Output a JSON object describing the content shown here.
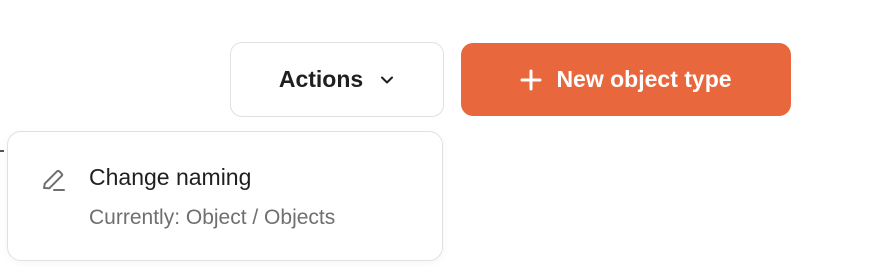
{
  "toolbar": {
    "actions_label": "Actions",
    "new_label": "New object type"
  },
  "dropdown": {
    "items": [
      {
        "icon": "pencil-icon",
        "label": "Change naming",
        "sublabel": "Currently: Object / Objects"
      }
    ]
  },
  "colors": {
    "accent": "#e8673c",
    "border": "#e4e1dc",
    "text": "#1f1f1f",
    "muted": "#6f6f6f"
  }
}
